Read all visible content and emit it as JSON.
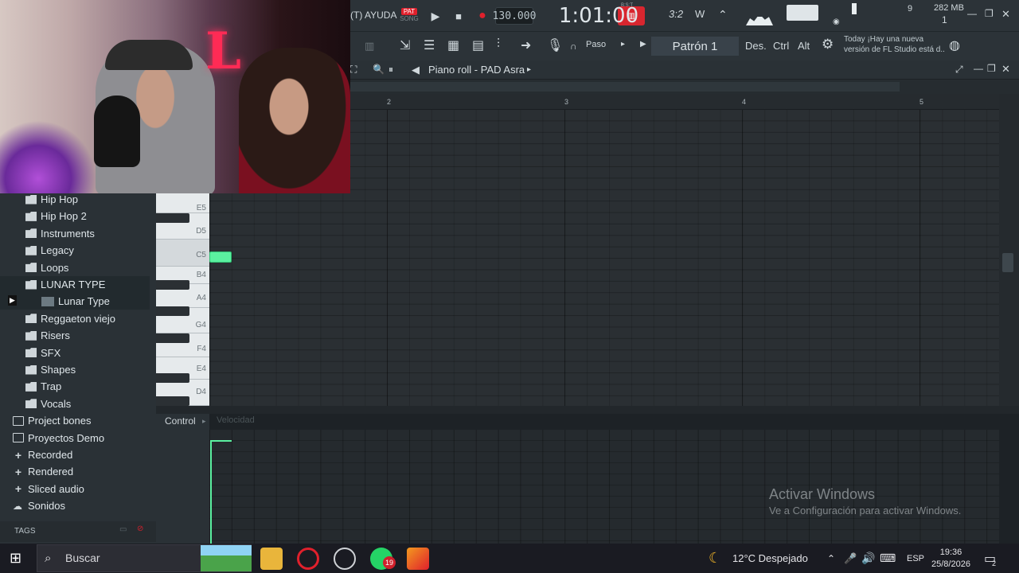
{
  "topbar": {
    "help_label": "(T) AYUDA",
    "mode_pat": "PAT",
    "mode_song": "SONG",
    "tempo": "130.000",
    "time": "1:01:00",
    "time_unit": "B:S:T",
    "cpu_label": "9",
    "memory": "282 MB",
    "voices": "1"
  },
  "toolbar2": {
    "snap_label": "Paso",
    "pattern_label": "Patrón 1",
    "des_label": "Des.",
    "ctrl_label": "Ctrl",
    "alt_label": "Alt",
    "news_line1": "Today  ¡Hay una nueva",
    "news_line2": "versión de FL Studio está d.."
  },
  "pianoroll": {
    "title": "Piano roll - PAD Asra",
    "bar_numbers": [
      "2",
      "3",
      "4",
      "5"
    ],
    "keys": [
      "E5",
      "D5",
      "C5",
      "B4",
      "A4",
      "G4",
      "F4",
      "E4",
      "D4"
    ],
    "control_label": "Control",
    "control_sub": "Velocidad"
  },
  "browser": {
    "items": [
      {
        "label": "Hip Hop",
        "type": "folder"
      },
      {
        "label": "Hip Hop 2",
        "type": "folder"
      },
      {
        "label": "Instruments",
        "type": "folder"
      },
      {
        "label": "Legacy",
        "type": "folder"
      },
      {
        "label": "Loops",
        "type": "folder"
      },
      {
        "label": "LUNAR TYPE",
        "type": "folder"
      },
      {
        "label": "Lunar Type",
        "type": "file"
      },
      {
        "label": "Reggaeton viejo",
        "type": "folder"
      },
      {
        "label": "Risers",
        "type": "folder"
      },
      {
        "label": "SFX",
        "type": "folder"
      },
      {
        "label": "Shapes",
        "type": "folder"
      },
      {
        "label": "Trap",
        "type": "folder"
      },
      {
        "label": "Vocals",
        "type": "folder"
      },
      {
        "label": "Project bones",
        "type": "folder-open"
      },
      {
        "label": "Proyectos Demo",
        "type": "folder-open"
      },
      {
        "label": "Recorded",
        "type": "plus"
      },
      {
        "label": "Rendered",
        "type": "plus"
      },
      {
        "label": "Sliced audio",
        "type": "plus"
      },
      {
        "label": "Sonidos",
        "type": "cloud"
      }
    ],
    "tags_label": "TAGS"
  },
  "watermark": {
    "line1": "Activar Windows",
    "line2": "Ve a Configuración para activar Windows."
  },
  "taskbar": {
    "search_placeholder": "Buscar",
    "weather": "12°C  Despejado",
    "language": "ESP",
    "clock_time": "19:36",
    "clock_date": "25/8/2026",
    "whatsapp_badge": "19",
    "notif_badge": "2"
  },
  "colors": {
    "note": "#5bf0a0",
    "accent_red": "#e0202c"
  }
}
